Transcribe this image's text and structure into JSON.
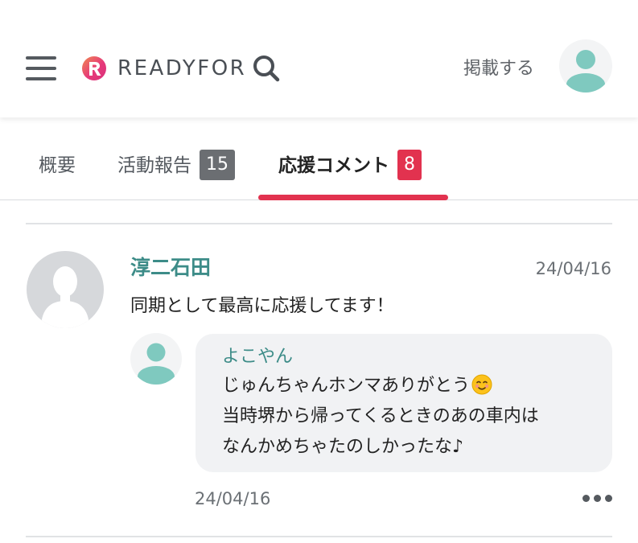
{
  "header": {
    "brand": "READYFOR",
    "post_label": "掲載する",
    "colors": {
      "brand_pink": "#e63a7a",
      "brand_orange": "#f07a4a",
      "teal": "#7fc9bf"
    }
  },
  "tabs": [
    {
      "label": "概要"
    },
    {
      "label": "活動報告",
      "badge": "15",
      "badge_color": "#6b6e72"
    },
    {
      "label": "応援コメント",
      "badge": "8",
      "badge_color": "#e2324f",
      "active": true
    }
  ],
  "comment": {
    "author": "淳二石田",
    "date": "24/04/16",
    "text": "同期として最高に応援してます！",
    "reply": {
      "author": "よこやん",
      "lines": [
        "じゅんちゃんホンマありがとう",
        "当時堺から帰ってくるときのあの車内は",
        "なんかめちゃたのしかったな♪"
      ],
      "emoji": "smiling-face-icon",
      "date": "24/04/16"
    }
  }
}
